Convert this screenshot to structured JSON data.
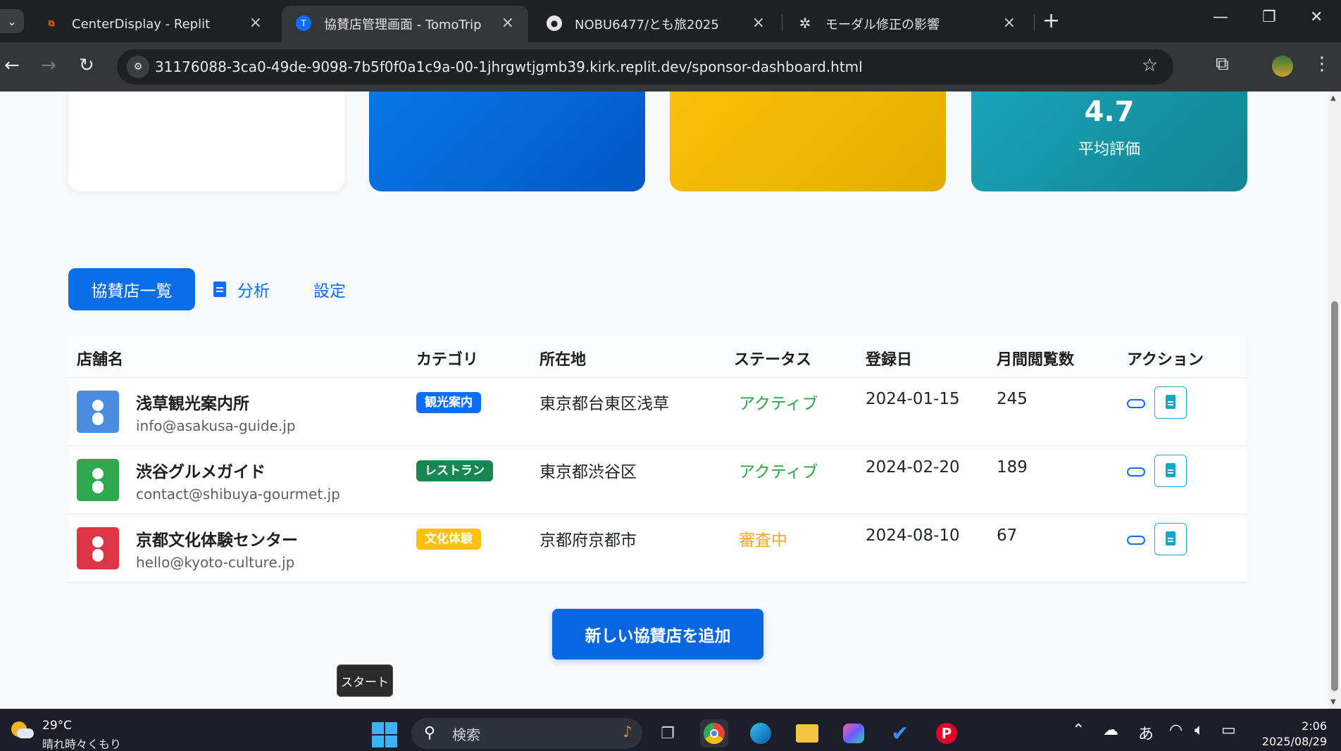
{
  "browser": {
    "tabs": [
      {
        "title": "CenterDisplay - Replit",
        "icon": "replit-icon"
      },
      {
        "title": "協賛店管理画面 - TomoTrip",
        "icon": "tomotrip-icon"
      },
      {
        "title": "NOBU6477/とも旅2025",
        "icon": "github-icon"
      },
      {
        "title": "モーダル修正の影響",
        "icon": "openai-icon"
      }
    ],
    "url": "31176088-3ca0-49de-9098-7b5f0f0a1c9a-00-1jhrgwtjgmb39.kirk.replit.dev/sponsor-dashboard.html"
  },
  "stats": {
    "rating_value": "4.7",
    "rating_label": "平均評価"
  },
  "tabs": {
    "list": "協賛店一覧",
    "analytics": "分析",
    "settings": "設定"
  },
  "table": {
    "headers": {
      "name": "店舗名",
      "category": "カテゴリ",
      "location": "所在地",
      "status": "ステータス",
      "registered": "登録日",
      "views": "月間閲覧数",
      "actions": "アクション"
    },
    "rows": [
      {
        "name": "浅草観光案内所",
        "email": "info@asakusa-guide.jp",
        "category": "観光案内",
        "category_color": "#0d6efd",
        "location": "東京都台東区浅草",
        "status": "アクティブ",
        "status_color": "#28a745",
        "registered": "2024-01-15",
        "views": "245",
        "icon_color": "#4a8de0"
      },
      {
        "name": "渋谷グルメガイド",
        "email": "contact@shibuya-gourmet.jp",
        "category": "レストラン",
        "category_color": "#198754",
        "location": "東京都渋谷区",
        "status": "アクティブ",
        "status_color": "#28a745",
        "registered": "2024-02-20",
        "views": "189",
        "icon_color": "#2fa84f"
      },
      {
        "name": "京都文化体験センター",
        "email": "hello@kyoto-culture.jp",
        "category": "文化体験",
        "category_color": "#ffc107",
        "location": "京都府京都市",
        "status": "審査中",
        "status_color": "#f5a623",
        "registered": "2024-08-10",
        "views": "67",
        "icon_color": "#dc3545"
      }
    ]
  },
  "add_button": "新しい協賛店を追加",
  "tooltip": "スタート",
  "taskbar": {
    "temperature": "29°C",
    "weather": "晴れ時々くもり",
    "search_placeholder": "検索",
    "ime": "あ",
    "time": "2:06",
    "date": "2025/08/29"
  }
}
